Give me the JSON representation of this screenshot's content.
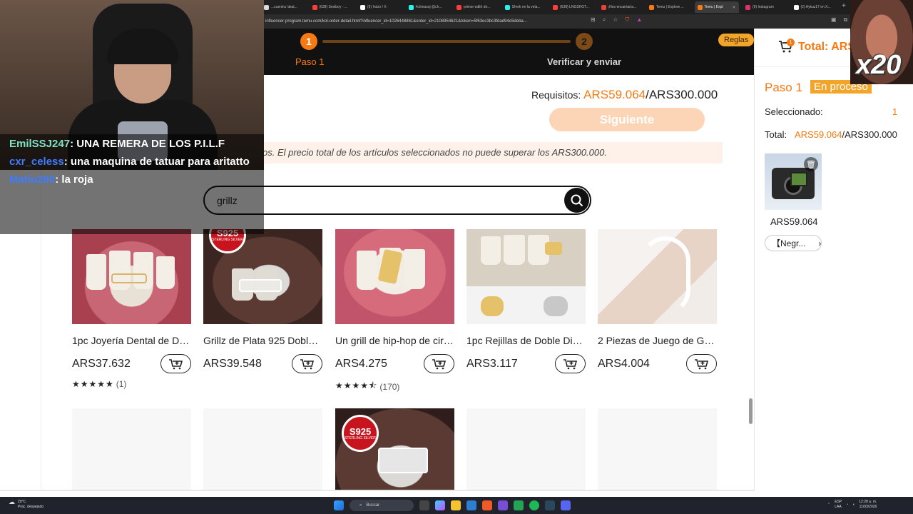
{
  "browser": {
    "tabs": [
      {
        "label": "...cuentra 'akat...",
        "color": "#d9d9d9"
      },
      {
        "label": "(638) Sexiboy - ...",
        "color": "#ff3d3d"
      },
      {
        "label": "(5) Inicio / X",
        "color": "#ffffff"
      },
      {
        "label": "#chinasoj @ch...",
        "color": "#25f4ee"
      },
      {
        "label": "primer edith de...",
        "color": "#ff3d3d"
      },
      {
        "label": "Shrek en la vela...",
        "color": "#25f4ee"
      },
      {
        "label": "(638) LNGSHOT...",
        "color": "#ff3d3d"
      },
      {
        "label": "¡Nos encantaría...",
        "color": "#ea4335"
      },
      {
        "label": "Temu | Explore ...",
        "color": "#f67a13"
      },
      {
        "label": "Temu | Expl",
        "color": "#f67a13"
      },
      {
        "label": "(9) Instagram",
        "color": "#e1306c"
      },
      {
        "label": "(2) Aykuz17 en X...",
        "color": "#ffffff"
      }
    ],
    "new_tab": "+",
    "url": "influencer-program.temu.com/kol-order-detail.html?influencer_id=1026448861&order_id=2108954621&token=5f63ec3bc3fdad94e5deba..."
  },
  "header": {
    "step1_number": "1",
    "step2_number": "2",
    "step1_label": "Paso 1",
    "step2_label": "Verificar y enviar",
    "rules_button": "Reglas"
  },
  "requirement": {
    "label": "Requisitos:",
    "current": "ARS59.064",
    "max": "/ARS300.000"
  },
  "next_button": "Siguiente",
  "note": "os. El precio total de los artículos seleccionados no puede superar los ARS300.000.",
  "search": {
    "value": "grillz"
  },
  "products": [
    {
      "name": "1pc Joyería Dental de Do...",
      "price": "ARS37.632",
      "stars": "★★★★★",
      "count": "(1)",
      "rating": 5,
      "has_badge": true
    },
    {
      "name": "Grillz de Plata 925 Doble ...",
      "price": "ARS39.548",
      "stars": "",
      "count": "",
      "has_badge": true
    },
    {
      "name": "Un grill de hip-hop de circ...",
      "price": "ARS4.275",
      "stars": "★★★★⯪",
      "count": "(170)",
      "rating": 4.5,
      "has_badge": false
    },
    {
      "name": "1pc Rejillas de Doble Die...",
      "price": "ARS3.117",
      "stars": "",
      "count": "",
      "has_badge": false
    },
    {
      "name": "2 Piezas de Juego de Gril...",
      "price": "ARS4.004",
      "stars": "",
      "count": "",
      "has_badge": false
    }
  ],
  "badge": {
    "line1": "S925",
    "line2": "STERLING SILVER"
  },
  "panel": {
    "cart_count": "1",
    "total_head": "Total: ARS",
    "step": "Paso 1",
    "status": "En proceso",
    "selected_label": "Seleccionado:",
    "selected_value": "1",
    "total_label": "Total:",
    "total_current": "ARS59.064",
    "total_max": "/ARS300.000",
    "item_price": "ARS59.064",
    "variant": "【Negr..."
  },
  "stream": {
    "chat": [
      {
        "user": "EmilSSJ247",
        "user_color": "#7fe3c4",
        "text": "UNA REMERA DE LOS P.I.L.F"
      },
      {
        "user": "cxr_celess",
        "user_color": "#3f7cff",
        "text": "una maquina de tatuar para aritatto"
      },
      {
        "user": "Matiu260",
        "user_color": "#3f7cff",
        "text": "la roja"
      }
    ],
    "multiplier": "x20"
  },
  "taskbar": {
    "weather_temp": "20°C",
    "weather_desc": "Prac. despejado",
    "search": "Buscar",
    "lang": "ESP",
    "lang2": "LAA",
    "time": "12:28 a. m.",
    "date": "11/03/2026"
  },
  "colors": {
    "accent": "#f67a13",
    "dark_header": "#111111",
    "next_button_disabled": "#fcd5b6"
  }
}
